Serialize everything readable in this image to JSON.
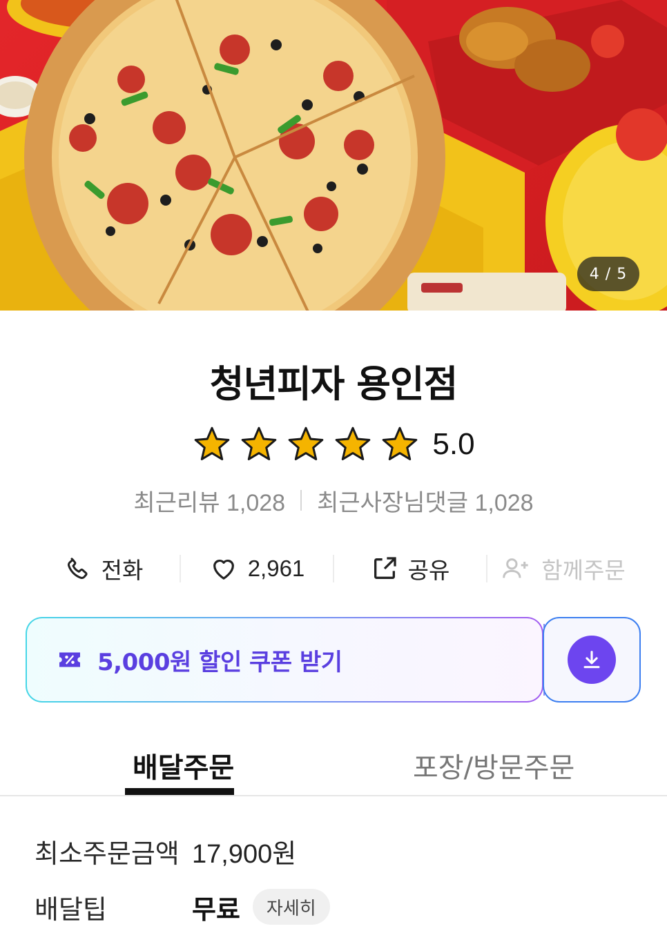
{
  "hero": {
    "image_counter": "4 / 5"
  },
  "store": {
    "name": "청년피자 용인점",
    "rating": "5.0",
    "stars_filled": 5,
    "stars_total": 5
  },
  "reviews": {
    "recent_reviews": "최근리뷰 1,028",
    "owner_replies": "최근사장님댓글 1,028"
  },
  "actions": {
    "call": "전화",
    "likes": "2,961",
    "share": "공유",
    "group_order": "함께주문"
  },
  "coupon": {
    "label": "5,000원 할인 쿠폰 받기"
  },
  "tabs": {
    "delivery": "배달주문",
    "pickup": "포장/방문주문"
  },
  "info": {
    "min_order_label": "최소주문금액",
    "min_order_value": "17,900원",
    "delivery_tip_label": "배달팁",
    "delivery_tip_value": "무료",
    "details_label": "자세히"
  },
  "colors": {
    "accent": "#5a3fe0",
    "download_button": "#6d45ef",
    "star": "#f5b400"
  }
}
